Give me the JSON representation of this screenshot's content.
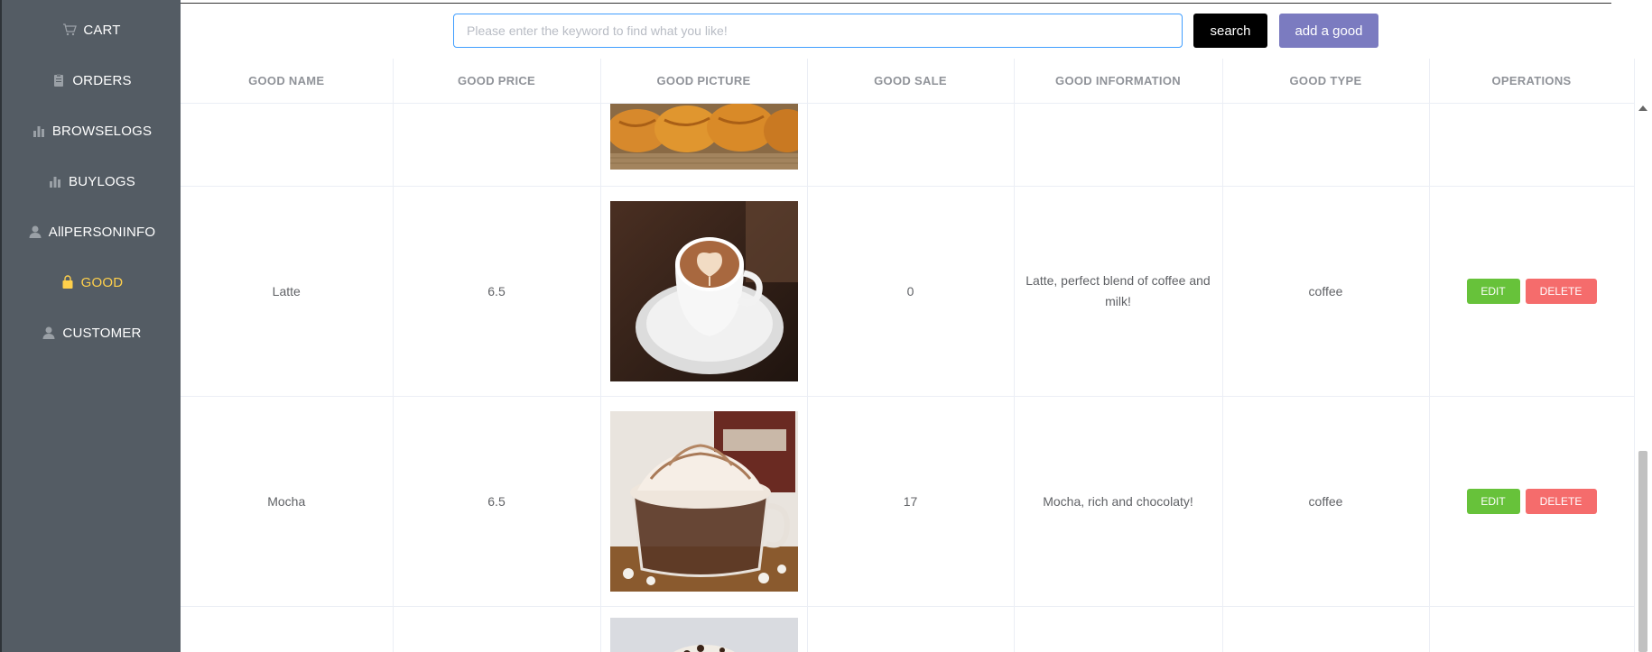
{
  "sidebar": {
    "items": [
      {
        "label": "CART",
        "icon": "cart-icon"
      },
      {
        "label": "ORDERS",
        "icon": "clipboard-icon"
      },
      {
        "label": "BROWSELOGS",
        "icon": "bar-chart-icon"
      },
      {
        "label": "BUYLOGS",
        "icon": "bar-chart-icon"
      },
      {
        "label": "AllPERSONINFO",
        "icon": "user-icon"
      },
      {
        "label": "GOOD",
        "icon": "shopping-bag-icon",
        "active": true
      },
      {
        "label": "CUSTOMER",
        "icon": "user-icon"
      }
    ],
    "background": "#545c64",
    "active_color": "#ffd04b"
  },
  "search": {
    "placeholder": "Please enter the keyword to find what you like!",
    "value": "",
    "button_label": "search",
    "add_label": "add a good"
  },
  "table": {
    "headers": [
      "GOOD NAME",
      "GOOD PRICE",
      "GOOD PICTURE",
      "GOOD SALE",
      "GOOD INFORMATION",
      "GOOD TYPE",
      "OPERATIONS"
    ],
    "rows": [
      {
        "name": "Latte",
        "price": "6.5",
        "picture": "latte-art-cup-image",
        "sale": "0",
        "info": "Latte, perfect blend of coffee and milk!",
        "type": "coffee"
      },
      {
        "name": "Mocha",
        "price": "6.5",
        "picture": "mocha-whipped-cream-image",
        "sale": "17",
        "info": "Mocha, rich and chocolaty!",
        "type": "coffee"
      }
    ],
    "edit_label": "EDIT",
    "delete_label": "DELETE"
  },
  "colors": {
    "edit": "#67c23a",
    "delete": "#f56c6c",
    "add": "#7b7bc0",
    "search": "#000000",
    "input_border": "#409eff"
  }
}
